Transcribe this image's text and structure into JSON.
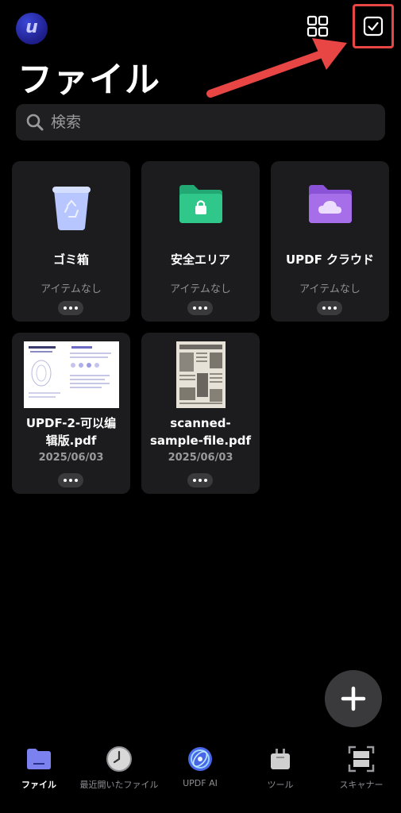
{
  "header": {
    "logo_letter": "u",
    "title": "ファイル"
  },
  "search": {
    "placeholder": "検索"
  },
  "folders": [
    {
      "name": "ゴミ箱",
      "subtitle": "アイテムなし",
      "icon": "trash-icon"
    },
    {
      "name": "安全エリア",
      "subtitle": "アイテムなし",
      "icon": "secure-folder-icon"
    },
    {
      "name": "UPDF クラウド",
      "subtitle": "アイテムなし",
      "icon": "cloud-folder-icon"
    }
  ],
  "files": [
    {
      "name_line1": "UPDF-2-可以编",
      "name_line2": "辑版.pdf",
      "date": "2025/06/03"
    },
    {
      "name_line1": "scanned-",
      "name_line2": "sample-file.pdf",
      "date": "2025/06/03"
    }
  ],
  "tabs": [
    {
      "label": "ファイル",
      "icon": "folder-icon",
      "active": true
    },
    {
      "label": "最近開いたファイル",
      "icon": "clock-icon",
      "active": false
    },
    {
      "label": "UPDF AI",
      "icon": "ai-icon",
      "active": false
    },
    {
      "label": "ツール",
      "icon": "toolbox-icon",
      "active": false
    },
    {
      "label": "スキャナー",
      "icon": "scanner-icon",
      "active": false
    }
  ],
  "colors": {
    "background": "#000000",
    "card": "#1c1c1e",
    "accent_red": "#e84545",
    "secure_green": "#2fc78a",
    "cloud_purple": "#a66ee8"
  }
}
